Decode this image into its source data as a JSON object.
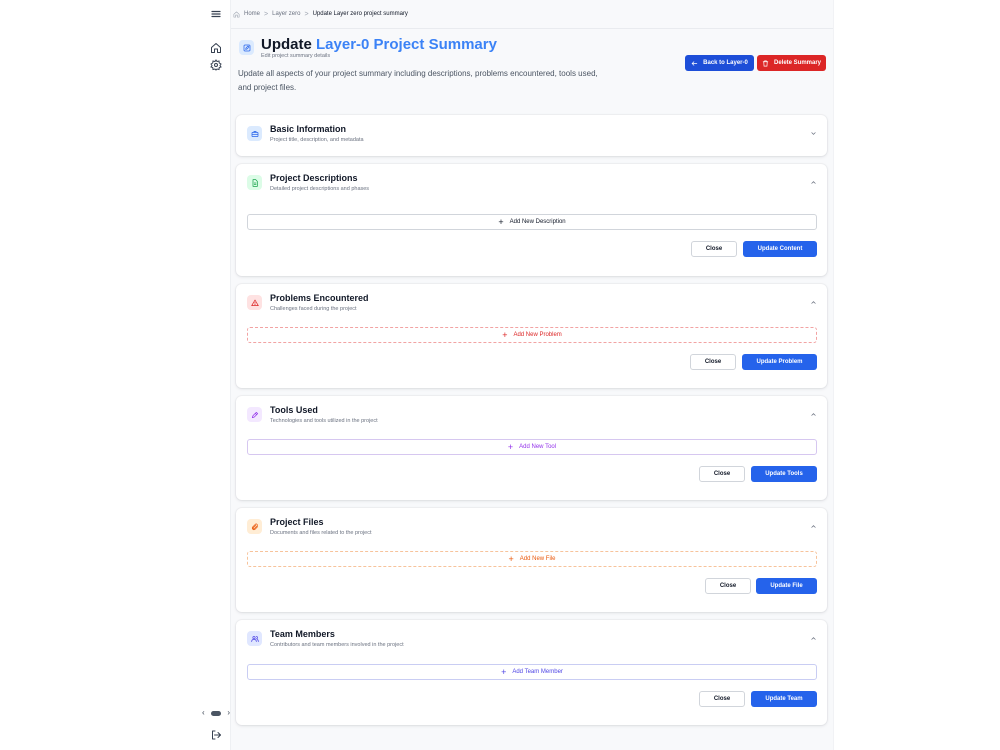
{
  "breadcrumb": {
    "home": "Home",
    "layer": "Layer zero",
    "current": "Update Layer zero project summary",
    "separator": ">"
  },
  "header": {
    "title_prefix": "Update",
    "title_accent": "Layer-0 Project Summary",
    "subtitle": "Edit project summary details",
    "description": "Update all aspects of your project summary including descriptions, problems encountered, tools used, and project files."
  },
  "actions": {
    "back_label": "Back to Layer-0",
    "delete_label": "Delete Summary"
  },
  "sections": {
    "basic": {
      "title": "Basic Information",
      "subtitle": "Project title, description, and metadata"
    },
    "descriptions": {
      "title": "Project Descriptions",
      "subtitle": "Detailed project descriptions and phases",
      "add_label": "Add New Description",
      "close_label": "Close",
      "update_label": "Update Content"
    },
    "problems": {
      "title": "Problems Encountered",
      "subtitle": "Challenges faced during the project",
      "add_label": "Add New Problem",
      "close_label": "Close",
      "update_label": "Update Problem"
    },
    "tools": {
      "title": "Tools Used",
      "subtitle": "Technologies and tools utilized in the project",
      "add_label": "Add New Tool",
      "close_label": "Close",
      "update_label": "Update Tools"
    },
    "files": {
      "title": "Project Files",
      "subtitle": "Documents and files related to the project",
      "add_label": "Add New File",
      "close_label": "Close",
      "update_label": "Update File"
    },
    "team": {
      "title": "Team Members",
      "subtitle": "Contributors and team members involved in the project",
      "add_label": "Add Team Member",
      "close_label": "Close",
      "update_label": "Update Team"
    }
  },
  "icons": {
    "menu": "menu-icon",
    "home": "home-icon",
    "settings": "gear-icon",
    "logout": "logout-icon",
    "edit": "edit-icon",
    "briefcase": "briefcase-icon",
    "document": "document-icon",
    "alert": "alert-triangle-icon",
    "tool": "pen-tool-icon",
    "paperclip": "paperclip-icon",
    "users": "users-icon"
  },
  "colors": {
    "primary": "#2563eb",
    "accent_title": "#3b82f6",
    "danger": "#dc2626",
    "purple": "#9333ea",
    "orange": "#ea580c",
    "indigo": "#4f46e5"
  }
}
